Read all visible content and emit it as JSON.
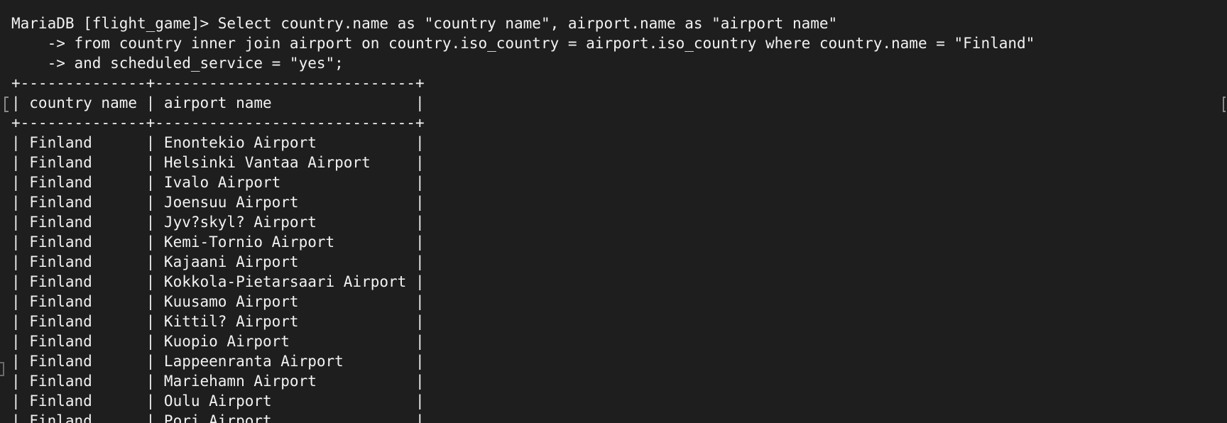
{
  "terminal": {
    "prompt": "MariaDB [flight_game]> Select country.name as \"country name\", airport.name as \"airport name\"",
    "continuation_1": "    -> from country inner join airport on country.iso_country = airport.iso_country where country.name = \"Finland\"",
    "continuation_2": "    -> and scheduled_service = \"yes\";",
    "table": {
      "border_top": "+--------------+-----------------------------+",
      "header_row": "| country name | airport name                |",
      "border_mid": "+--------------+-----------------------------+",
      "rows": [
        "| Finland      | Enontekio Airport           |",
        "| Finland      | Helsinki Vantaa Airport     |",
        "| Finland      | Ivalo Airport               |",
        "| Finland      | Joensuu Airport             |",
        "| Finland      | Jyv?skyl? Airport           |",
        "| Finland      | Kemi-Tornio Airport         |",
        "| Finland      | Kajaani Airport             |",
        "| Finland      | Kokkola-Pietarsaari Airport |",
        "| Finland      | Kuusamo Airport             |",
        "| Finland      | Kittil? Airport             |",
        "| Finland      | Kuopio Airport              |",
        "| Finland      | Lappeenranta Airport        |",
        "| Finland      | Mariehamn Airport           |",
        "| Finland      | Oulu Airport                |",
        "| Finland      | Pori Airport                |"
      ]
    }
  }
}
